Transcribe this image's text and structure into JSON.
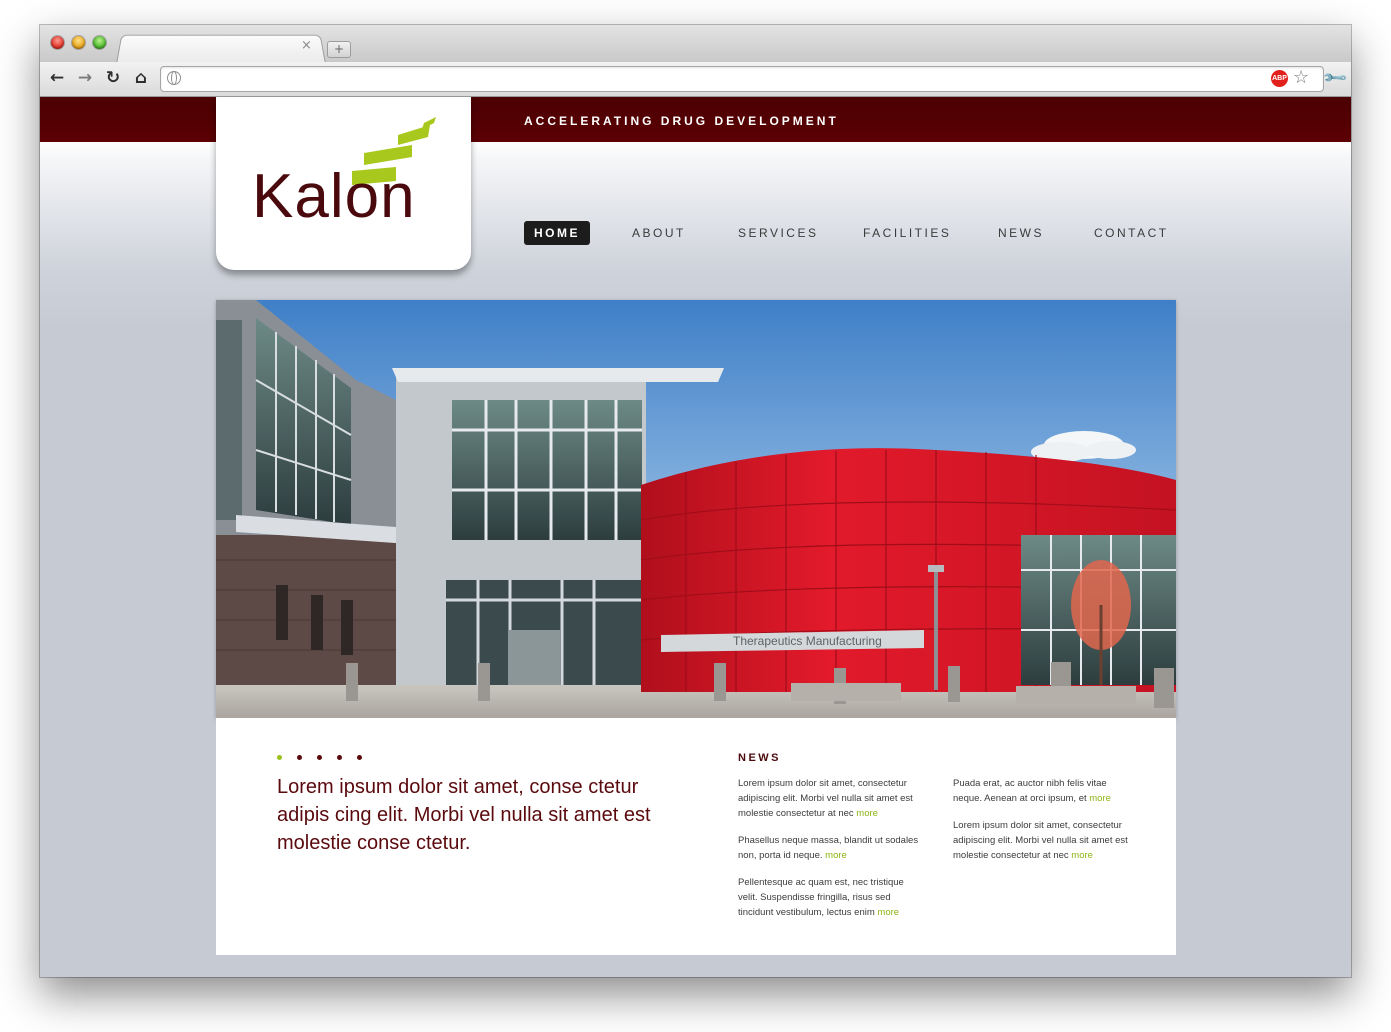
{
  "browser": {
    "tab_close": "×",
    "new_tab": "+",
    "address": "",
    "abp_label": "ABP"
  },
  "site": {
    "tagline": "ACCELERATING DRUG DEVELOPMENT",
    "logo_text": "Kalon",
    "colors": {
      "brand_maroon": "#5c0004",
      "accent_green": "#9bc21a",
      "text_maroon": "#5a0a0d"
    },
    "nav": [
      {
        "label": "HOME",
        "active": true
      },
      {
        "label": "ABOUT",
        "active": false
      },
      {
        "label": "SERVICES",
        "active": false
      },
      {
        "label": "FACILITIES",
        "active": false
      },
      {
        "label": "NEWS",
        "active": false
      },
      {
        "label": "CONTACT",
        "active": false
      }
    ],
    "hero": {
      "building_sign": "Therapeutics Manufacturing",
      "slides": 5,
      "active_slide": 1
    },
    "lead_text": "Lorem ipsum dolor sit amet, conse ctetur adipis cing elit. Morbi vel nulla sit amet est molestie conse ctetur.",
    "news": {
      "title": "NEWS",
      "more_label": "more",
      "col1": [
        {
          "text": "Lorem ipsum dolor sit amet, consectetur adipiscing elit. Morbi vel nulla sit amet est molestie consectetur at nec"
        },
        {
          "text": "Phasellus neque massa, blandit ut sodales non, porta id neque."
        },
        {
          "text": "Pellentesque ac quam est, nec tristique velit. Suspendisse fringilla, risus sed tincidunt vestibulum, lectus enim"
        }
      ],
      "col2": [
        {
          "text": "Puada erat, ac auctor nibh felis vitae neque. Aenean at orci ipsum, et"
        },
        {
          "text": "Lorem ipsum dolor sit amet, consectetur adipiscing elit. Morbi vel nulla sit amet est molestie consectetur at nec"
        }
      ]
    }
  }
}
